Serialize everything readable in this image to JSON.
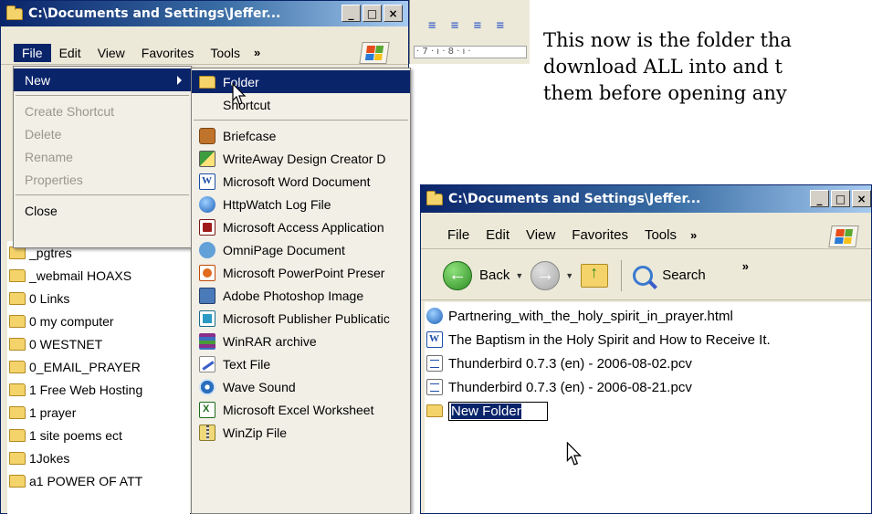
{
  "caption": [
    "This now is the folder tha",
    "download ALL into and t",
    "them before opening any"
  ],
  "window1": {
    "title": "C:\\Documents and Settings\\Jeffer...",
    "controls": [
      "_",
      "□",
      "×"
    ],
    "menus": [
      "File",
      "Edit",
      "View",
      "Favorites",
      "Tools"
    ],
    "more_menus": "»",
    "ruler_text": "· 7 · ı · 8 · ı ·"
  },
  "file_menu": [
    {
      "label": "New",
      "state": "highlighted",
      "submenu": true
    },
    {
      "separator": true
    },
    {
      "label": "Create Shortcut",
      "state": "disabled"
    },
    {
      "label": "Delete",
      "state": "disabled"
    },
    {
      "label": "Rename",
      "state": "disabled"
    },
    {
      "label": "Properties",
      "state": "disabled"
    },
    {
      "separator": true
    },
    {
      "label": "Close",
      "state": "normal"
    }
  ],
  "new_submenu": [
    {
      "label": "Folder",
      "icon": "folder-icon",
      "state": "highlighted"
    },
    {
      "label": "Shortcut",
      "icon": "",
      "state": "normal"
    },
    {
      "separator": true
    },
    {
      "label": "Briefcase",
      "icon": "briefcase-icon"
    },
    {
      "label": "WriteAway Design Creator D",
      "icon": "writeaway-icon"
    },
    {
      "label": "Microsoft Word Document",
      "icon": "word-document-icon"
    },
    {
      "label": "HttpWatch Log File",
      "icon": "httpwatch-icon"
    },
    {
      "label": "Microsoft Access Application",
      "icon": "access-icon"
    },
    {
      "label": "OmniPage Document",
      "icon": "omnipage-icon"
    },
    {
      "label": "Microsoft PowerPoint Preser",
      "icon": "powerpoint-icon"
    },
    {
      "label": "Adobe Photoshop Image",
      "icon": "photoshop-icon"
    },
    {
      "label": "Microsoft Publisher Publicatic",
      "icon": "publisher-icon"
    },
    {
      "label": "WinRAR archive",
      "icon": "winrar-icon"
    },
    {
      "label": "Text File",
      "icon": "text-file-icon"
    },
    {
      "label": "Wave Sound",
      "icon": "wave-sound-icon"
    },
    {
      "label": "Microsoft Excel Worksheet",
      "icon": "excel-icon"
    },
    {
      "label": "WinZip File",
      "icon": "winzip-icon"
    }
  ],
  "folder_tree": [
    "_pgtres",
    "_webmail HOAXS",
    "0 Links",
    "0 my computer",
    "0 WESTNET",
    "0_EMAIL_PRAYER",
    "1 Free Web Hosting",
    "1 prayer",
    "1 site poems ect",
    "1Jokes",
    "a1 POWER OF ATT"
  ],
  "window2": {
    "title": "C:\\Documents and Settings\\Jeffer...",
    "controls": [
      "_",
      "□",
      "×"
    ],
    "menus": [
      "File",
      "Edit",
      "View",
      "Favorites",
      "Tools"
    ],
    "more_menus": "»",
    "toolbar": {
      "back_label": "Back",
      "search_label": "Search",
      "more": "»"
    },
    "files": [
      {
        "name": "Partnering_with_the_holy_spirit_in_prayer.html",
        "icon": "html-file-icon"
      },
      {
        "name": "The Baptism in the Holy Spirit and How to Receive It.",
        "icon": "word-document-icon"
      },
      {
        "name": "Thunderbird 0.7.3 (en) - 2006-08-02.pcv",
        "icon": "pcv-file-icon"
      },
      {
        "name": "Thunderbird 0.7.3 (en) - 2006-08-21.pcv",
        "icon": "pcv-file-icon"
      }
    ],
    "rename_value": "New Folder"
  }
}
